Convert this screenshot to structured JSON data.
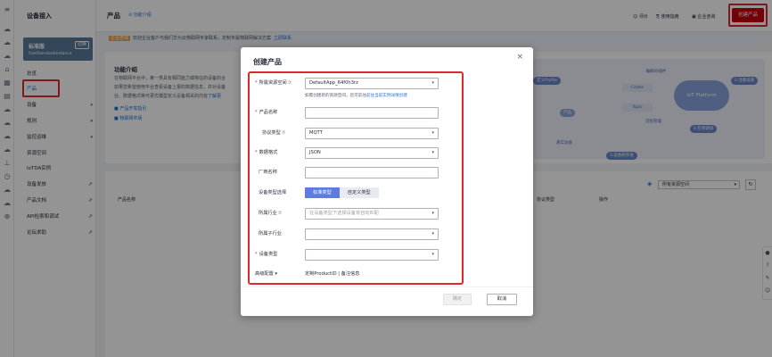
{
  "sidebar": {
    "title": "设备接入",
    "instance": {
      "edition": "标准版",
      "switch_label": "切换",
      "name": "freeStandardInstance"
    },
    "items": [
      {
        "label": "总览"
      },
      {
        "label": "产品"
      },
      {
        "label": "设备",
        "caret": "▾"
      },
      {
        "label": "规则",
        "caret": "▾"
      },
      {
        "label": "监控运维",
        "caret": "▾"
      },
      {
        "label": "资源空间"
      },
      {
        "label": "IoTDA实例"
      },
      {
        "label": "设备发放"
      },
      {
        "label": "产品文档"
      },
      {
        "label": "API检索和调试"
      },
      {
        "label": "论坛求助"
      }
    ]
  },
  "header": {
    "title": "产品",
    "help": "功能介绍",
    "links": [
      "评价",
      "使用指南",
      "企业咨询"
    ],
    "create_button": "创建产品"
  },
  "notice": {
    "tag": "企业咨询",
    "text": "欢迎企业客户与我们华为云物联网专家联系，定制专属物联网解决方案",
    "link": "立即联系"
  },
  "intro": {
    "heading": "功能介绍",
    "line1": "在物联网平台中，某一类具有相同能力或特征的设备的合",
    "line2": "如果您希望使用平台查看设备上报的数据信息，并对设备",
    "line3": "业、数据格式等可更优模型定义设备相关的内容",
    "more": "了解更",
    "link1": "产品开发指引",
    "link2": "物联网市场"
  },
  "flow": {
    "profile": "定义Profile",
    "codec": "编解码插件",
    "codec_box": "Codec",
    "topic": "Topic",
    "product": "产品",
    "flow_manage": "流程管理",
    "platform": "IoT Platform",
    "step2": "2.注册设备",
    "step4": "4.在线调试",
    "step3": "3.设备侧开发",
    "real_device": "真实设备"
  },
  "list": {
    "resource_space": "所有资源空间",
    "col_name": "产品名称",
    "col_protocol": "协议类型",
    "col_op": "操作"
  },
  "dialog": {
    "title": "创建产品",
    "fields": {
      "space": {
        "label": "所属资源空间",
        "value": "DefaultApp_64f0h3rz"
      },
      "space_hint": "如需创建新的资源空间，您可前往",
      "space_hint_link": "前往当前实例详情创建",
      "name": {
        "label": "产品名称",
        "value": ""
      },
      "protocol": {
        "label": "协议类型",
        "value": "MQTT"
      },
      "format": {
        "label": "数据格式",
        "value": "JSON"
      },
      "vendor": {
        "label": "厂商名称",
        "value": ""
      },
      "device_type_select": {
        "label": "设备类型选择",
        "opt1": "标准类型",
        "opt2": "自定义类型"
      },
      "industry": {
        "label": "所属行业",
        "placeholder": "在设备类型下选择设备将自动匹配"
      },
      "sub_industry": {
        "label": "所属子行业",
        "value": ""
      },
      "device_type": {
        "label": "设备类型",
        "value": ""
      },
      "advanced": {
        "label": "高级配置",
        "value": "定制ProductID | 备注信息"
      }
    },
    "ok": "确定",
    "cancel": "取消"
  }
}
